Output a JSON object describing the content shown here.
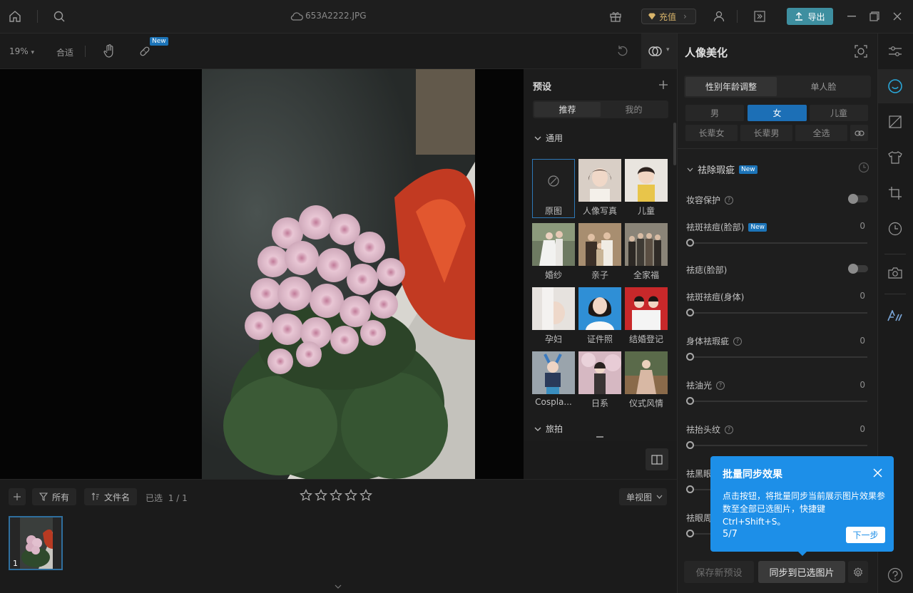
{
  "titlebar": {
    "filename": "653A2222.JPG",
    "recharge_label": "充值",
    "export_label": "导出"
  },
  "toolbar": {
    "zoom": "19%",
    "fit_label": "合适",
    "new_badge": "New"
  },
  "presets": {
    "title": "预设",
    "tabs": [
      "推荐",
      "我的"
    ],
    "active_tab": 0,
    "section_general": "通用",
    "section_travel": "旅拍",
    "items": [
      {
        "label": "原图"
      },
      {
        "label": "人像写真"
      },
      {
        "label": "儿童"
      },
      {
        "label": "婚纱"
      },
      {
        "label": "亲子"
      },
      {
        "label": "全家福"
      },
      {
        "label": "孕妇"
      },
      {
        "label": "证件照"
      },
      {
        "label": "结婚登记"
      },
      {
        "label": "Cospla..."
      },
      {
        "label": "日系"
      },
      {
        "label": "仪式风情"
      }
    ]
  },
  "filmstrip": {
    "filter_all": "所有",
    "sort_label": "文件名",
    "selected_label": "已选",
    "selected_count": "1 / 1",
    "view_mode": "单视图",
    "rating_stars": 5,
    "thumb_index": "1"
  },
  "rpanel": {
    "title": "人像美化",
    "segments": [
      "性别年龄调整",
      "单人脸"
    ],
    "gender_buttons": [
      "男",
      "女",
      "儿童"
    ],
    "gender_active": 1,
    "age_buttons": [
      "长辈女",
      "长辈男",
      "全选"
    ],
    "section_title": "祛除瑕疵",
    "section_badge": "New",
    "sliders": [
      {
        "label": "妆容保护",
        "type": "toggle",
        "help": true
      },
      {
        "label": "祛斑祛痘(脸部)",
        "value": "0",
        "type": "slider",
        "badge": "New"
      },
      {
        "label": "祛痣(脸部)",
        "type": "toggle"
      },
      {
        "label": "祛斑祛痘(身体)",
        "value": "0",
        "type": "slider"
      },
      {
        "label": "身体祛瑕疵",
        "value": "0",
        "type": "slider",
        "help": true
      },
      {
        "label": "祛油光",
        "value": "0",
        "type": "slider",
        "help": true
      },
      {
        "label": "祛抬头纹",
        "value": "0",
        "type": "slider",
        "help": true
      },
      {
        "label": "祛黑眼",
        "type": "slider"
      },
      {
        "label": "祛眼周",
        "type": "slider"
      }
    ],
    "save_preset_label": "保存新预设",
    "sync_label": "同步到已选图片"
  },
  "tooltip": {
    "title": "批量同步效果",
    "body": "点击按钮，将批量同步当前展示图片效果参数至全部已选图片，快捷键 Ctrl+Shift+S。",
    "step": "5/7",
    "next_label": "下一步"
  },
  "colors": {
    "accent_blue": "#1d8fe8",
    "active_button": "#1c6fb6",
    "export_teal": "#3e8fa0",
    "recharge_gold": "#d8b46a"
  }
}
